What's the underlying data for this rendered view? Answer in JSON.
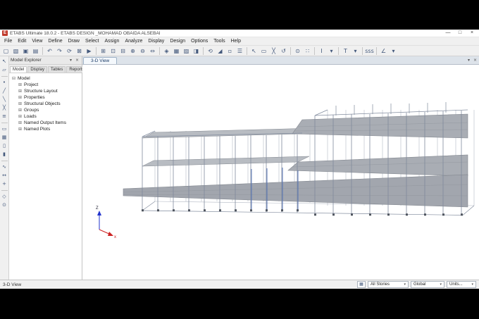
{
  "window": {
    "logo_text": "E",
    "title": "ETABS Ultimate 18.0.2 - ETABS DESIGN _MOHAMAD OBAIDA ALSEBAI",
    "minimize": "—",
    "maximize": "□",
    "close": "×"
  },
  "menubar": {
    "items": [
      "File",
      "Edit",
      "View",
      "Define",
      "Draw",
      "Select",
      "Assign",
      "Analyze",
      "Display",
      "Design",
      "Options",
      "Tools",
      "Help"
    ]
  },
  "toolbar": {
    "icons": [
      {
        "name": "new-model-icon",
        "glyph": "▢"
      },
      {
        "name": "open-model-icon",
        "glyph": "▧"
      },
      {
        "name": "save-model-icon",
        "glyph": "▣"
      },
      {
        "name": "print-icon",
        "glyph": "▤"
      },
      {
        "sep": true
      },
      {
        "name": "undo-icon",
        "glyph": "↶"
      },
      {
        "name": "redo-icon",
        "glyph": "↷"
      },
      {
        "name": "refresh-window-icon",
        "glyph": "⟳"
      },
      {
        "name": "lock-model-icon",
        "glyph": "⊠"
      },
      {
        "name": "run-analysis-icon",
        "glyph": "▶"
      },
      {
        "sep": true
      },
      {
        "name": "rubber-band-zoom-icon",
        "glyph": "⊞"
      },
      {
        "name": "restore-full-view-icon",
        "glyph": "⊡"
      },
      {
        "name": "previous-zoom-icon",
        "glyph": "⊟"
      },
      {
        "name": "zoom-in-icon",
        "glyph": "⊕"
      },
      {
        "name": "zoom-out-icon",
        "glyph": "⊖"
      },
      {
        "name": "pan-icon",
        "glyph": "⇔"
      },
      {
        "sep": true
      },
      {
        "name": "three-d-view-icon",
        "glyph": "◈"
      },
      {
        "name": "plan-view-icon",
        "glyph": "▦"
      },
      {
        "name": "elevation-view-icon",
        "glyph": "▨"
      },
      {
        "name": "named-view-icon",
        "glyph": "◨"
      },
      {
        "sep": true
      },
      {
        "name": "rotate-3d-view-icon",
        "glyph": "⟲"
      },
      {
        "name": "perspective-toggle-icon",
        "glyph": "◢"
      },
      {
        "name": "object-shrink-icon",
        "glyph": "▫"
      },
      {
        "name": "display-options-icon",
        "glyph": "☰"
      },
      {
        "sep": true
      },
      {
        "name": "select-pointer-icon",
        "glyph": "↖"
      },
      {
        "name": "select-all-icon",
        "glyph": "▭"
      },
      {
        "name": "clear-selection-icon",
        "glyph": "╳"
      },
      {
        "name": "previous-selection-icon",
        "glyph": "↺"
      },
      {
        "sep": true
      },
      {
        "name": "snap-to-points-icon",
        "glyph": "⊙"
      },
      {
        "name": "snap-to-grid-icon",
        "glyph": "∷"
      },
      {
        "sep": true
      },
      {
        "name": "i-section-icon",
        "glyph": "I"
      },
      {
        "name": "i-section-caret-icon",
        "glyph": "▾"
      },
      {
        "sep": true
      },
      {
        "name": "t-section-icon",
        "glyph": "T"
      },
      {
        "name": "t-section-caret-icon",
        "glyph": "▾"
      },
      {
        "sep": true
      },
      {
        "name": "sss-display-icon",
        "glyph": "sss"
      },
      {
        "sep": true
      },
      {
        "name": "angle-icon",
        "glyph": "∠"
      },
      {
        "name": "angle-caret-icon",
        "glyph": "▾"
      }
    ]
  },
  "side_toolbar": {
    "icons": [
      {
        "name": "pointer-tool-icon",
        "glyph": "↖"
      },
      {
        "name": "reshape-tool-icon",
        "glyph": "▱"
      },
      {
        "sep": true
      },
      {
        "name": "draw-joint-icon",
        "glyph": "•"
      },
      {
        "name": "draw-frame-icon",
        "glyph": "╱"
      },
      {
        "name": "quick-draw-frame-icon",
        "glyph": "╲"
      },
      {
        "name": "quick-draw-braces-icon",
        "glyph": "╳"
      },
      {
        "name": "quick-draw-secondary-beams-icon",
        "glyph": "≡"
      },
      {
        "sep": true
      },
      {
        "name": "draw-floor-icon",
        "glyph": "▭"
      },
      {
        "name": "quick-draw-floor-icon",
        "glyph": "▦"
      },
      {
        "name": "draw-wall-icon",
        "glyph": "▯"
      },
      {
        "name": "quick-draw-wall-icon",
        "glyph": "▮"
      },
      {
        "sep": true
      },
      {
        "name": "draw-links-icon",
        "glyph": "∿"
      },
      {
        "name": "draw-dimension-icon",
        "glyph": "↔"
      },
      {
        "name": "draw-reference-point-icon",
        "glyph": "+"
      },
      {
        "sep": true
      },
      {
        "name": "select-polygon-icon",
        "glyph": "◇"
      },
      {
        "name": "measure-tool-icon",
        "glyph": "⊙"
      }
    ]
  },
  "explorer": {
    "title": "Model Explorer",
    "menu_button": "▾",
    "close_button": "×",
    "tabs": [
      {
        "label": "Model",
        "active": true
      },
      {
        "label": "Display"
      },
      {
        "label": "Tables"
      },
      {
        "label": "Reports"
      }
    ],
    "root": {
      "toggle": "⊟",
      "label": "Model"
    },
    "items": [
      {
        "toggle": "⊞",
        "label": "Project"
      },
      {
        "toggle": "⊞",
        "label": "Structure Layout"
      },
      {
        "toggle": "⊞",
        "label": "Properties"
      },
      {
        "toggle": "⊞",
        "label": "Structural Objects"
      },
      {
        "toggle": "⊞",
        "label": "Groups"
      },
      {
        "toggle": "⊞",
        "label": "Loads"
      },
      {
        "toggle": "⊞",
        "label": "Named Output Items"
      },
      {
        "toggle": "⊞",
        "label": "Named Plots"
      }
    ]
  },
  "viewport": {
    "tab_label": "3-D View",
    "menu_button": "▾",
    "close_button": "×",
    "axis_z": "Z",
    "axis_x": "x"
  },
  "statusbar": {
    "view_label": "3-D View",
    "grid_icon": "▦",
    "stories_value": "All Stories",
    "coord_value": "Global",
    "units_label": "Units...",
    "caret": "▾"
  },
  "colors": {
    "accent_blue": "#4f6fb5",
    "slab_gray": "#a9adb4",
    "frame_gray": "#7f8a9c",
    "axis_z_blue": "#2233cc",
    "axis_x_red": "#cc2222"
  }
}
